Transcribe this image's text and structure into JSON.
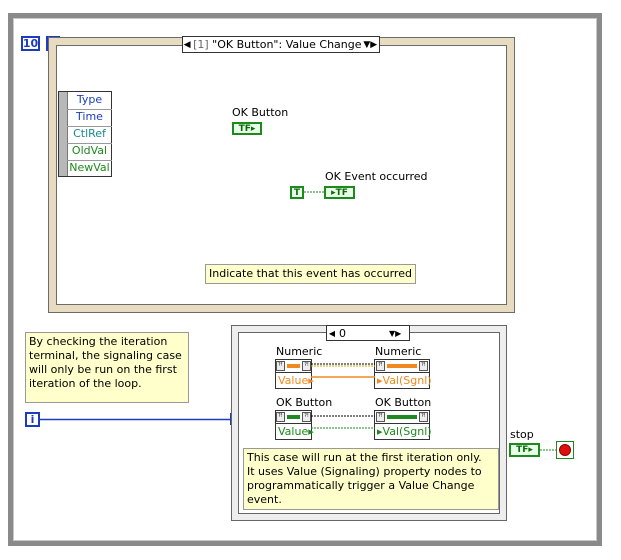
{
  "loop": {
    "count_value": "10",
    "iteration_label": "i"
  },
  "event_structure": {
    "selector_index": "[1]",
    "selector_label": "\"OK Button\": Value Change",
    "data_fields": [
      "Type",
      "Time",
      "CtlRef",
      "OldVal",
      "NewVal"
    ],
    "ok_button_label": "OK Button",
    "ok_button_terminal": "TF",
    "true_constant": "T",
    "indicator_label": "OK Event occurred",
    "indicator_terminal": "TF",
    "comment": "Indicate that this event has occurred"
  },
  "left_comment": "By checking the iteration terminal, the signaling case will only be run on the first iteration of the loop.",
  "case_structure": {
    "selector_value": "0",
    "numeric_label_in": "Numeric",
    "numeric_label_out": "Numeric",
    "numeric_prop_in": "Value",
    "numeric_prop_out": "Val(Sgnl)",
    "button_label_in": "OK Button",
    "button_label_out": "OK Button",
    "button_prop_in": "Value",
    "button_prop_out": "Val(Sgnl)",
    "comment_line1": "This case will run at the first iteration only.",
    "comment_line2": "It uses Value (Signaling) property nodes to",
    "comment_line3": "programmatically trigger a Value Change event."
  },
  "stop": {
    "label": "stop",
    "terminal": "TF"
  },
  "colors": {
    "boolean_wire": "#1c8a1c",
    "numeric_wire": "#f08a20",
    "integer_wire": "#1c3bbf",
    "event_frame": "#b8aa80"
  }
}
